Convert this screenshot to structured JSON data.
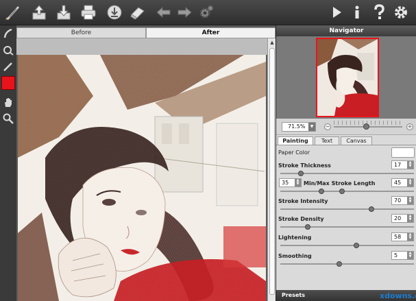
{
  "toolbar": {
    "icons": [
      "app-logo-icon",
      "open-file-icon",
      "save-file-icon",
      "print-icon",
      "batch-icon",
      "eraser-icon",
      "undo-arrow-icon",
      "redo-arrow-icon",
      "settings-gear-small-icon",
      "play-icon",
      "info-icon",
      "help-icon",
      "gear-icon"
    ]
  },
  "left_tools": [
    "pen-tool-icon",
    "smudge-tool-icon",
    "brush-tool-icon",
    "color-swatch",
    "hand-tool-icon",
    "zoom-tool-icon"
  ],
  "colors": {
    "active_color": "#e8141c",
    "toolbar_bg": "#3a3a3a"
  },
  "canvas": {
    "tab_before": "Before",
    "tab_after": "After"
  },
  "navigator": {
    "title": "Navigator",
    "zoom_value": "71.5%"
  },
  "panel": {
    "tabs": [
      "Painting",
      "Text",
      "Canvas"
    ],
    "paper_color_label": "Paper Color",
    "stroke_thickness_label": "Stroke Thickness",
    "stroke_thickness": "17",
    "min_stroke": "35",
    "minmax_label": "Min/Max Stroke Length",
    "max_stroke": "45",
    "stroke_intensity_label": "Stroke Intensity",
    "stroke_intensity": "70",
    "stroke_density_label": "Stroke Density",
    "stroke_density": "20",
    "lightening_label": "Lightening",
    "lightening": "58",
    "smoothing_label": "Smoothing",
    "smoothing": "5",
    "presets_label": "Presets"
  },
  "watermark": "xdowns.com"
}
